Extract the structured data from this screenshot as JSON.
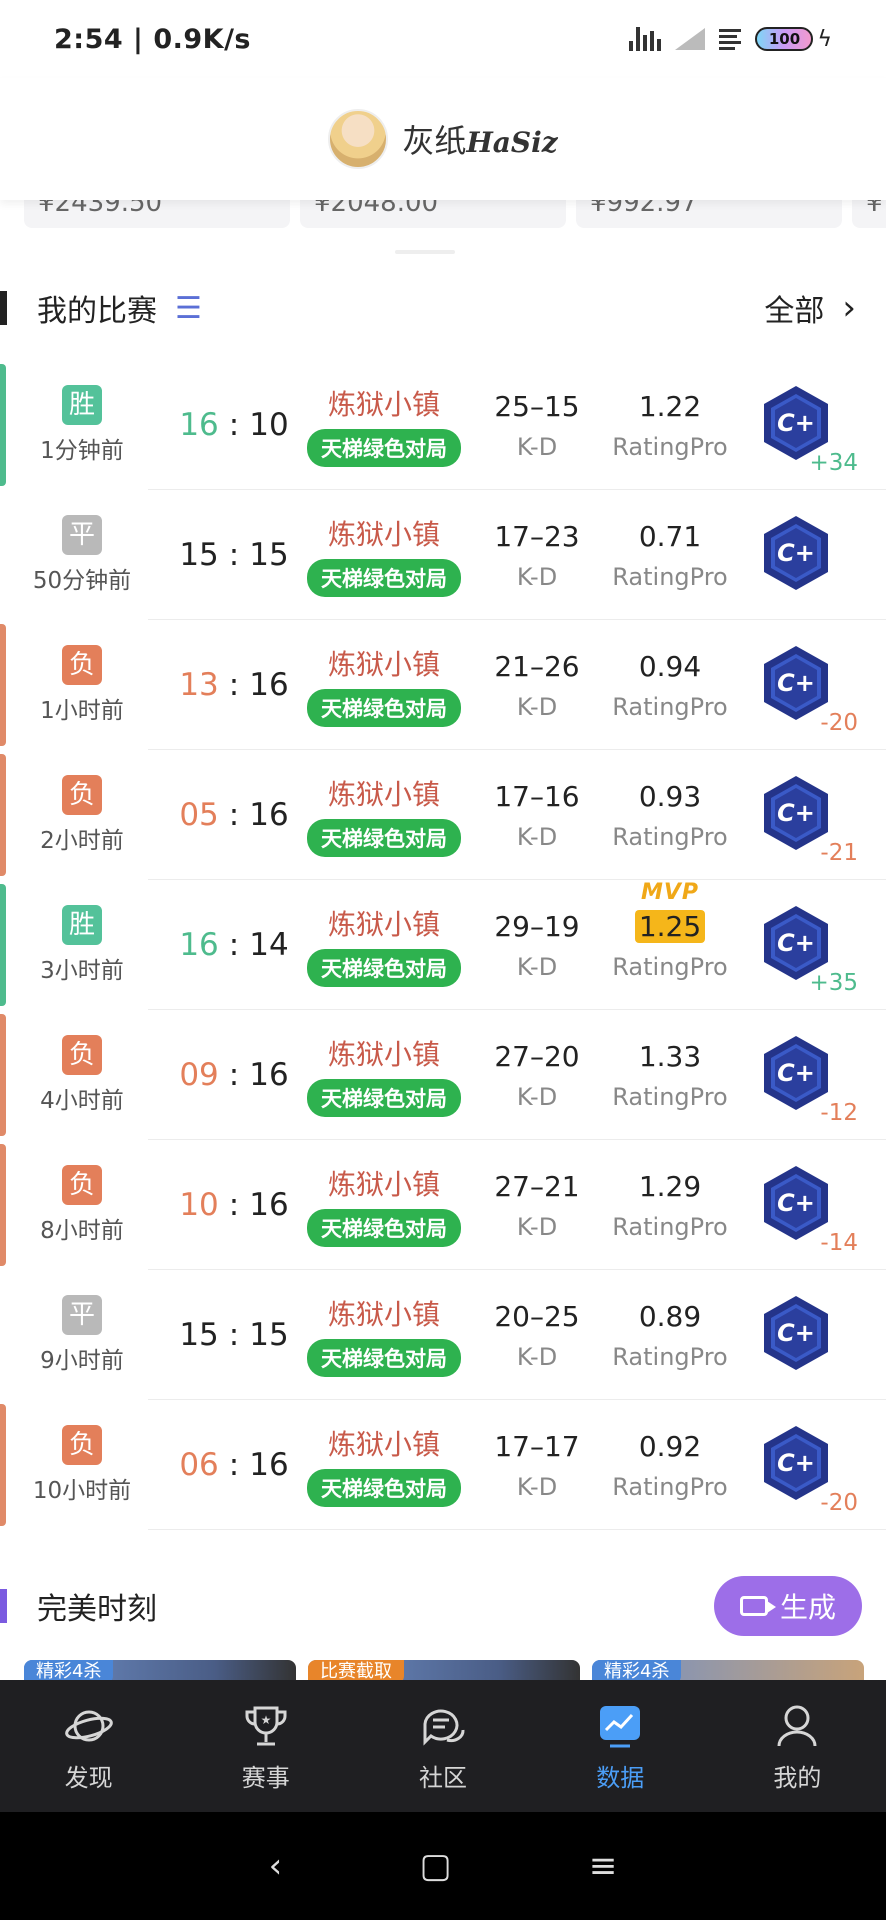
{
  "status_bar": {
    "time": "2:54 | 0.9K/s",
    "battery": "100"
  },
  "header": {
    "title_cn": "灰纸",
    "title_en": "HaSiz"
  },
  "wallet": {
    "cards": [
      "¥2439.50",
      "¥2048.00",
      "¥992.97",
      "¥"
    ]
  },
  "my_matches": {
    "title": "我的比赛",
    "all_label": "全部",
    "kd_label": "K-D",
    "rating_label": "RatingPro",
    "mvp_label": "MVP",
    "rows": [
      {
        "result": "胜",
        "type": "win",
        "time": "1分钟前",
        "score_left": "16",
        "score_right": "10",
        "map": "炼狱小镇",
        "mode": "天梯绿色对局",
        "kd": "25–15",
        "rating": "1.22",
        "delta": "+34"
      },
      {
        "result": "平",
        "type": "draw",
        "time": "50分钟前",
        "score_left": "15",
        "score_right": "15",
        "map": "炼狱小镇",
        "mode": "天梯绿色对局",
        "kd": "17–23",
        "rating": "0.71",
        "delta": ""
      },
      {
        "result": "负",
        "type": "loss",
        "time": "1小时前",
        "score_left": "13",
        "score_right": "16",
        "map": "炼狱小镇",
        "mode": "天梯绿色对局",
        "kd": "21–26",
        "rating": "0.94",
        "delta": "-20"
      },
      {
        "result": "负",
        "type": "loss",
        "time": "2小时前",
        "score_left": "05",
        "score_right": "16",
        "map": "炼狱小镇",
        "mode": "天梯绿色对局",
        "kd": "17–16",
        "rating": "0.93",
        "delta": "-21"
      },
      {
        "result": "胜",
        "type": "win",
        "time": "3小时前",
        "score_left": "16",
        "score_right": "14",
        "map": "炼狱小镇",
        "mode": "天梯绿色对局",
        "kd": "29–19",
        "rating": "1.25",
        "mvp": true,
        "delta": "+35"
      },
      {
        "result": "负",
        "type": "loss",
        "time": "4小时前",
        "score_left": "09",
        "score_right": "16",
        "map": "炼狱小镇",
        "mode": "天梯绿色对局",
        "kd": "27–20",
        "rating": "1.33",
        "delta": "-12"
      },
      {
        "result": "负",
        "type": "loss",
        "time": "8小时前",
        "score_left": "10",
        "score_right": "16",
        "map": "炼狱小镇",
        "mode": "天梯绿色对局",
        "kd": "27–21",
        "rating": "1.29",
        "delta": "-14"
      },
      {
        "result": "平",
        "type": "draw",
        "time": "9小时前",
        "score_left": "15",
        "score_right": "15",
        "map": "炼狱小镇",
        "mode": "天梯绿色对局",
        "kd": "20–25",
        "rating": "0.89",
        "delta": ""
      },
      {
        "result": "负",
        "type": "loss",
        "time": "10小时前",
        "score_left": "06",
        "score_right": "16",
        "map": "炼狱小镇",
        "mode": "天梯绿色对局",
        "kd": "17–17",
        "rating": "0.92",
        "delta": "-20"
      }
    ]
  },
  "moments": {
    "title": "完美时刻",
    "generate_label": "生成",
    "thumbs": [
      "精彩4杀",
      "比赛截取",
      "精彩4杀"
    ]
  },
  "bottom_nav": [
    {
      "label": "发现",
      "icon": "planet-icon",
      "active": false
    },
    {
      "label": "赛事",
      "icon": "trophy-icon",
      "active": false
    },
    {
      "label": "社区",
      "icon": "chat-bubbles-icon",
      "active": false
    },
    {
      "label": "数据",
      "icon": "chart-icon",
      "active": true
    },
    {
      "label": "我的",
      "icon": "profile-icon",
      "active": false
    }
  ],
  "colors": {
    "win": "#4ebb8d",
    "loss": "#e37f5a",
    "draw": "#b9b9b9",
    "map_text": "#c85a4a",
    "mode_tag": "#2eb24f",
    "rank_badge": "#24348a",
    "nav_active": "#4b9ef7",
    "generate": "#9d6ee8"
  }
}
